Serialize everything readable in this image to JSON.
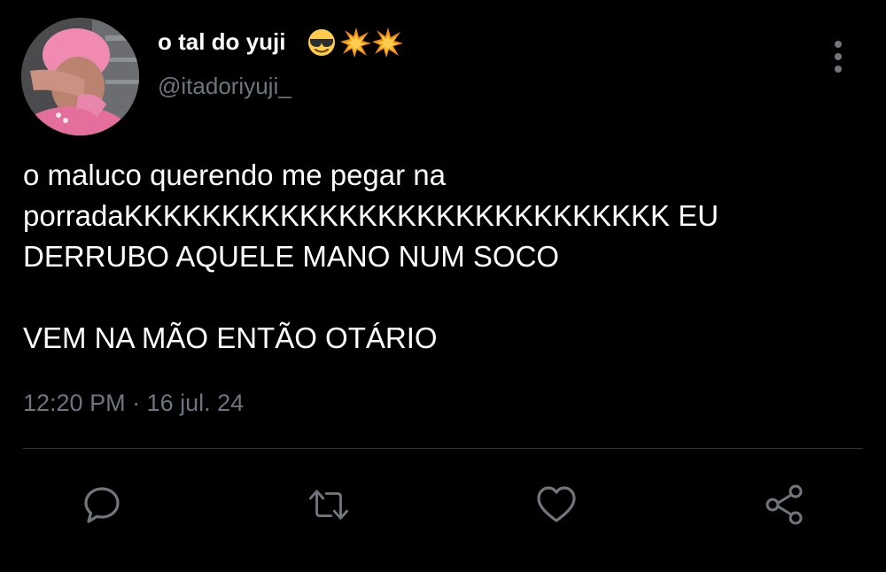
{
  "tweet": {
    "display_name": "o tal do yuji",
    "name_emojis": [
      "sunglasses-emoji",
      "collision-emoji",
      "collision-emoji"
    ],
    "handle": "@itadoriyuji_",
    "text_lines": [
      "o maluco querendo me pegar na",
      "porradaKKKKKKKKKKKKKKKKKKKKKKKKKKKK EU",
      "DERRUBO AQUELE MANO NUM SOCO",
      "VEM NA MÃO ENTÃO OTÁRIO"
    ],
    "timestamp": "12:20 PM · 16 jul. 24"
  },
  "actions": {
    "reply_icon": "reply-icon",
    "retweet_icon": "retweet-icon",
    "like_icon": "like-icon",
    "share_icon": "share-icon"
  },
  "colors": {
    "background": "#000000",
    "primary_text": "#ffffff",
    "secondary_text": "#6e767d",
    "divider": "#2f3336",
    "icon": "#71767b",
    "avatar_hair": "#f08ab0"
  }
}
